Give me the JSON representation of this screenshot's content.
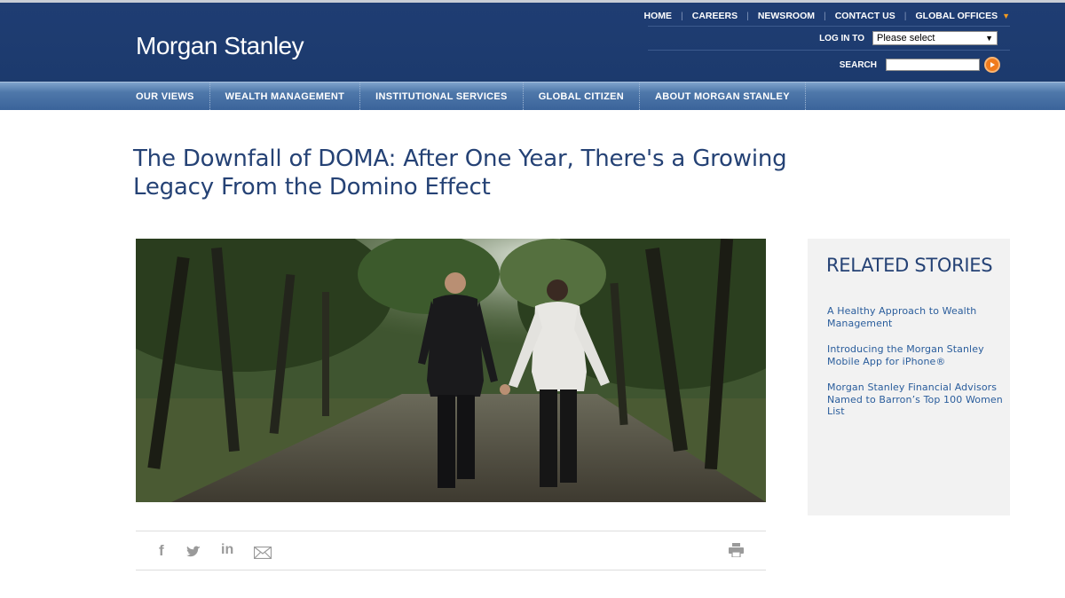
{
  "header": {
    "logo": "Morgan Stanley",
    "utility_links": [
      "HOME",
      "CAREERS",
      "NEWSROOM",
      "CONTACT US",
      "GLOBAL OFFICES"
    ],
    "login_label": "LOG IN TO",
    "login_select_value": "Please select",
    "search_label": "SEARCH",
    "search_value": ""
  },
  "nav": {
    "items": [
      "OUR VIEWS",
      "WEALTH MANAGEMENT",
      "INSTITUTIONAL SERVICES",
      "GLOBAL CITIZEN",
      "ABOUT MORGAN STANLEY"
    ]
  },
  "article": {
    "title": "The Downfall of DOMA: After One Year, There's a Growing Legacy From the Domino Effect"
  },
  "share": {
    "icons": [
      "facebook-icon",
      "twitter-icon",
      "linkedin-icon",
      "email-icon",
      "print-icon"
    ]
  },
  "related": {
    "heading": "RELATED STORIES",
    "stories": [
      "A Healthy Approach to Wealth Management",
      "Introducing the Morgan Stanley Mobile App for iPhone®",
      "Morgan Stanley Financial Advisors Named to Barron’s Top 100 Women List"
    ]
  },
  "colors": {
    "header_bg": "#1f3d73",
    "nav_bg": "#4f78aa",
    "headline": "#254275",
    "link": "#2a5d9c",
    "accent": "#f07b1d"
  }
}
